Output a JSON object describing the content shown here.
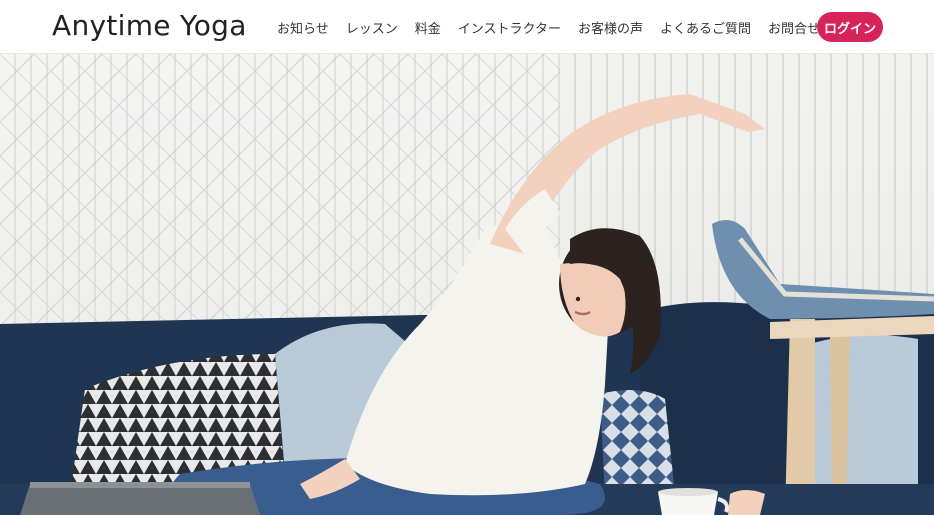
{
  "brand": {
    "logo_text": "Anytime Yoga"
  },
  "nav": {
    "items": [
      {
        "label": "お知らせ"
      },
      {
        "label": "レッスン"
      },
      {
        "label": "料金"
      },
      {
        "label": "インストラクター"
      },
      {
        "label": "お客様の声"
      },
      {
        "label": "よくあるご質問"
      },
      {
        "label": "お問合せ"
      }
    ],
    "login_label": "ログイン"
  },
  "colors": {
    "accent": "#d6245a",
    "text": "#333333"
  },
  "hero": {
    "image_subject": "woman-doing-side-stretch-on-sofa-photo"
  }
}
